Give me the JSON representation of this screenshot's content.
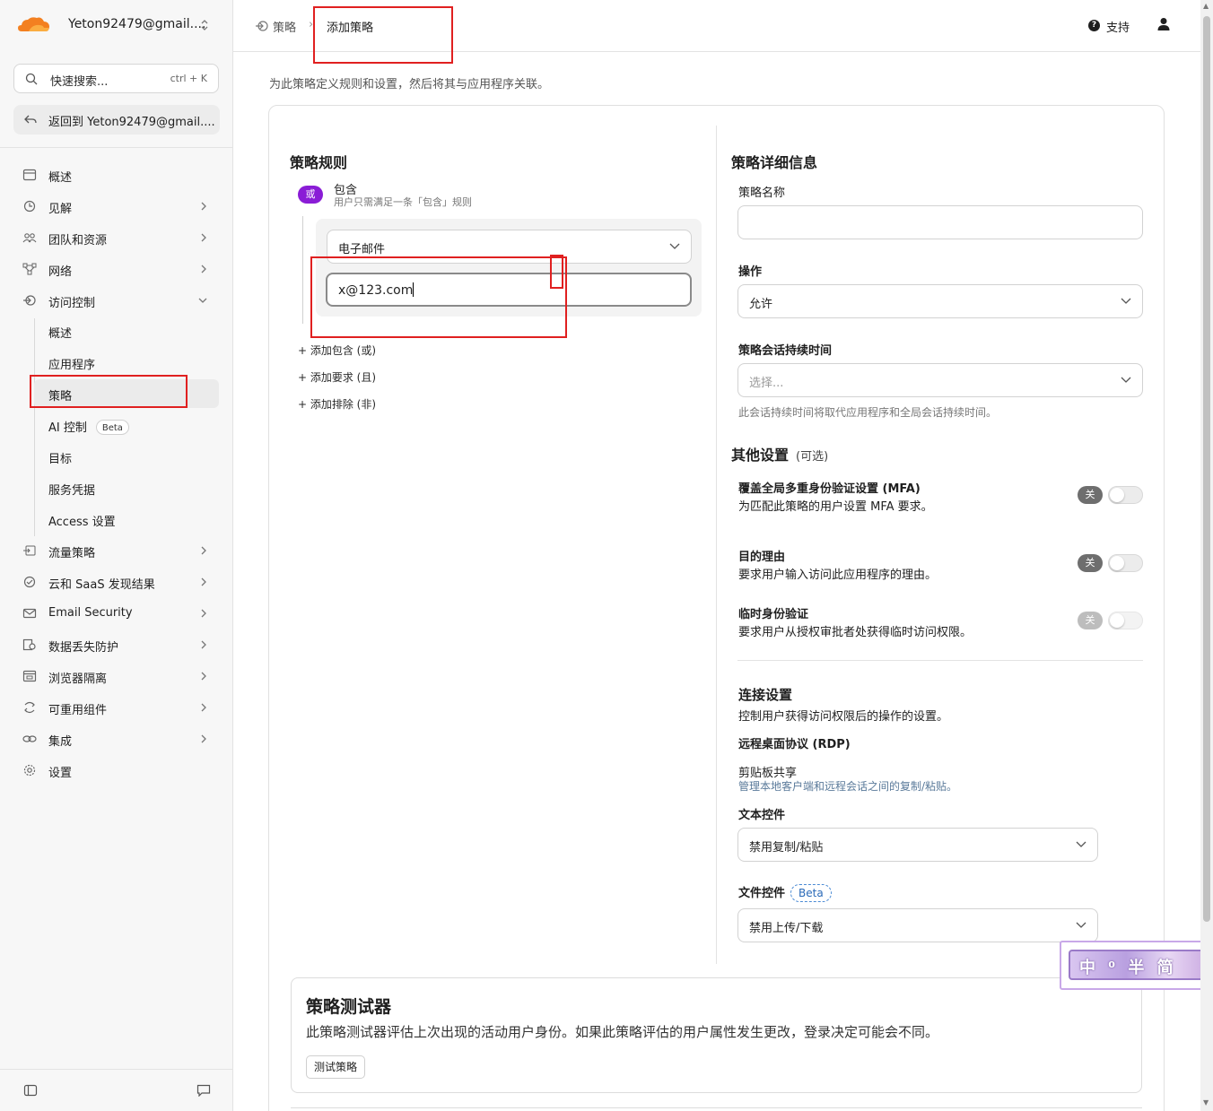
{
  "sidebar": {
    "account_name": "Yeton92479@gmail....",
    "search_placeholder": "快速搜索...",
    "search_shortcut": "ctrl + K",
    "back_label": "返回到 Yeton92479@gmail....",
    "items": [
      {
        "label": "概述",
        "icon": "overview-icon"
      },
      {
        "label": "见解",
        "icon": "insights-icon"
      },
      {
        "label": "团队和资源",
        "icon": "team-icon"
      },
      {
        "label": "网络",
        "icon": "network-icon"
      },
      {
        "label": "访问控制",
        "icon": "access-icon"
      },
      {
        "label": "流量策略",
        "icon": "traffic-icon"
      },
      {
        "label": "云和 SaaS 发现结果",
        "icon": "cloud-icon"
      },
      {
        "label": "Email Security",
        "icon": "email-icon"
      },
      {
        "label": "数据丢失防护",
        "icon": "dlp-icon"
      },
      {
        "label": "浏览器隔离",
        "icon": "browser-icon"
      },
      {
        "label": "可重用组件",
        "icon": "components-icon"
      },
      {
        "label": "集成",
        "icon": "integration-icon"
      },
      {
        "label": "设置",
        "icon": "settings-icon"
      }
    ],
    "sub_items": [
      {
        "label": "概述"
      },
      {
        "label": "应用程序"
      },
      {
        "label": "策略"
      },
      {
        "label": "AI 控制",
        "badge": "Beta"
      },
      {
        "label": "目标"
      },
      {
        "label": "服务凭据"
      },
      {
        "label": "Access 设置"
      }
    ]
  },
  "header": {
    "breadcrumb_parent": "策略",
    "breadcrumb_current": "添加策略",
    "support_label": "支持"
  },
  "page": {
    "description": "为此策略定义规则和设置，然后将其与应用程序关联。"
  },
  "rules": {
    "title": "策略规则",
    "or_badge": "或",
    "include_title": "包含",
    "include_sub": "用户只需满足一条「包含」规则",
    "selector_value": "电子邮件",
    "email_value": "x@123.com",
    "add_include": "+ 添加包含 (或)",
    "add_require": "+ 添加要求 (且)",
    "add_exclude": "+ 添加排除 (非)"
  },
  "details": {
    "title": "策略详细信息",
    "name_label": "策略名称",
    "name_value": "",
    "action_label": "操作",
    "action_value": "允许",
    "session_label": "策略会话持续时间",
    "session_placeholder": "选择...",
    "session_hint": "此会话持续时间将取代应用程序和全局会话持续时间。"
  },
  "other": {
    "title": "其他设置",
    "optional": "(可选)",
    "off_label": "关",
    "settings": [
      {
        "title": "覆盖全局多重身份验证设置 (MFA)",
        "sub": "为匹配此策略的用户设置 MFA 要求。",
        "on": false
      },
      {
        "title": "目的理由",
        "sub": "要求用户输入访问此应用程序的理由。",
        "on": false
      },
      {
        "title": "临时身份验证",
        "sub": "要求用户从授权审批者处获得临时访问权限。",
        "on": false
      }
    ]
  },
  "connection": {
    "title": "连接设置",
    "sub": "控制用户获得访问权限后的操作的设置。",
    "rdp_title": "远程桌面协议 (RDP)",
    "clipboard_title": "剪贴板共享",
    "clipboard_sub": "管理本地客户端和远程会话之间的复制/粘贴。",
    "text_control_label": "文本控件",
    "text_control_value": "禁用复制/粘贴",
    "file_control_label": "文件控件",
    "file_control_badge": "Beta",
    "file_control_value": "禁用上传/下载"
  },
  "tester": {
    "title": "策略测试器",
    "description": "此策略测试器评估上次出现的活动用户身份。如果此策略评估的用户属性发生更改，登录决定可能会不同。",
    "button": "测试策略"
  },
  "ime": {
    "text": "中 ⁰ 半 简"
  },
  "colors": {
    "brand_orange": "#f38020",
    "or_badge": "#8a1cd6",
    "annotation_red": "#e02020"
  }
}
